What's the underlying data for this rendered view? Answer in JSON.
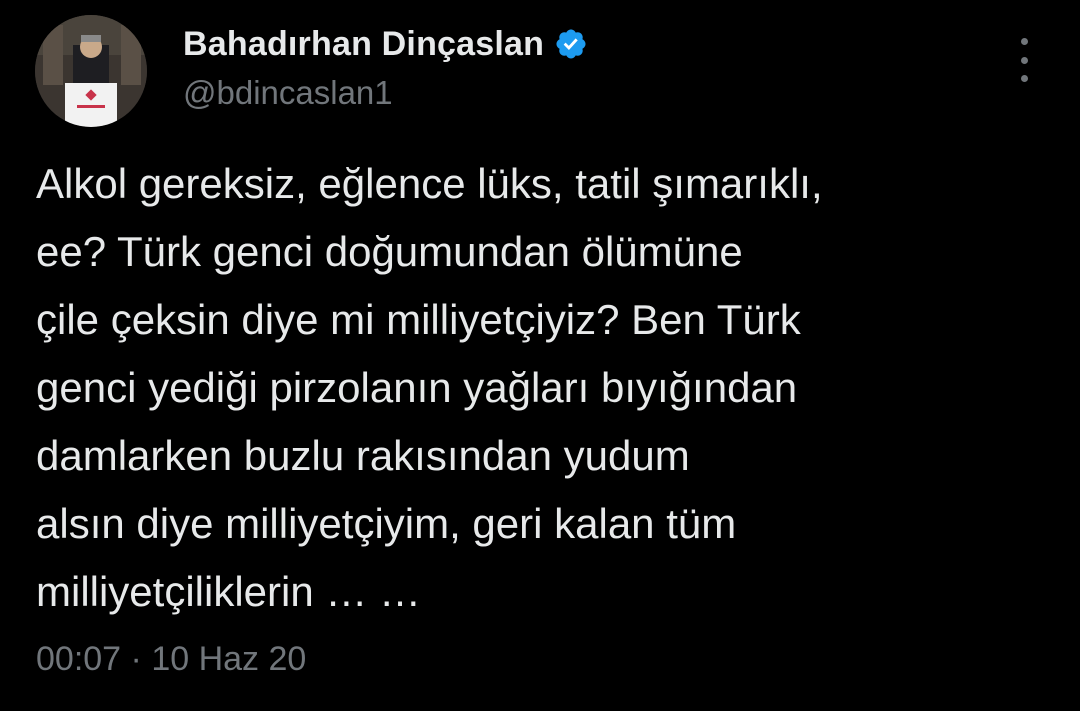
{
  "author": {
    "display_name": "Bahadırhan Dinçaslan",
    "handle": "@bdincaslan1",
    "verified": true,
    "verified_color": "#1d9bf0"
  },
  "tweet": {
    "lines": [
      "Alkol gereksiz, eğlence lüks, tatil şımarıklı,",
      "ee? Türk genci doğumundan ölümüne",
      "çile çeksin diye mi milliyetçiyiz? Ben Türk",
      "genci yediği pirzolanın yağları bıyığından",
      "damlarken buzlu rakısından yudum",
      "alsın diye milliyetçiyim, geri kalan tüm",
      "milliyetçiliklerin … …"
    ],
    "time": "00:07",
    "separator": "·",
    "date": "10 Haz 20"
  },
  "icons": {
    "more": "more-vertical-icon",
    "verified": "verified-badge-icon"
  },
  "colors": {
    "background": "#000000",
    "text": "#e7e9ea",
    "secondary": "#71767b"
  }
}
